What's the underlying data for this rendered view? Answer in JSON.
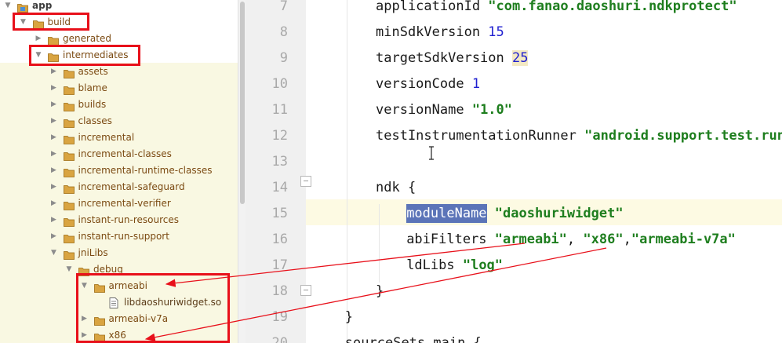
{
  "project_tree": {
    "items": [
      {
        "label": "app",
        "depth": 0,
        "expanded": true,
        "kind": "module",
        "bold": true
      },
      {
        "label": "build",
        "depth": 1,
        "expanded": true,
        "kind": "folder"
      },
      {
        "label": "generated",
        "depth": 2,
        "expanded": false,
        "kind": "folder"
      },
      {
        "label": "intermediates",
        "depth": 2,
        "expanded": true,
        "kind": "folder"
      },
      {
        "label": "assets",
        "depth": 3,
        "expanded": false,
        "kind": "folder"
      },
      {
        "label": "blame",
        "depth": 3,
        "expanded": false,
        "kind": "folder"
      },
      {
        "label": "builds",
        "depth": 3,
        "expanded": false,
        "kind": "folder"
      },
      {
        "label": "classes",
        "depth": 3,
        "expanded": false,
        "kind": "folder"
      },
      {
        "label": "incremental",
        "depth": 3,
        "expanded": false,
        "kind": "folder"
      },
      {
        "label": "incremental-classes",
        "depth": 3,
        "expanded": false,
        "kind": "folder"
      },
      {
        "label": "incremental-runtime-classes",
        "depth": 3,
        "expanded": false,
        "kind": "folder"
      },
      {
        "label": "incremental-safeguard",
        "depth": 3,
        "expanded": false,
        "kind": "folder"
      },
      {
        "label": "incremental-verifier",
        "depth": 3,
        "expanded": false,
        "kind": "folder"
      },
      {
        "label": "instant-run-resources",
        "depth": 3,
        "expanded": false,
        "kind": "folder"
      },
      {
        "label": "instant-run-support",
        "depth": 3,
        "expanded": false,
        "kind": "folder"
      },
      {
        "label": "jniLibs",
        "depth": 3,
        "expanded": true,
        "kind": "folder"
      },
      {
        "label": "debug",
        "depth": 4,
        "expanded": true,
        "kind": "folder"
      },
      {
        "label": "armeabi",
        "depth": 5,
        "expanded": true,
        "kind": "folder"
      },
      {
        "label": "libdaoshuriwidget.so",
        "depth": 6,
        "expanded": null,
        "kind": "file"
      },
      {
        "label": "armeabi-v7a",
        "depth": 5,
        "expanded": false,
        "kind": "folder"
      },
      {
        "label": "x86",
        "depth": 5,
        "expanded": false,
        "kind": "folder"
      }
    ]
  },
  "editor": {
    "line_numbers": [
      "7",
      "8",
      "9",
      "10",
      "11",
      "12",
      "13",
      "14",
      "15",
      "16",
      "17",
      "18",
      "19",
      "20"
    ],
    "lines": [
      {
        "indent": 2,
        "tokens": [
          {
            "t": "applicationId ",
            "c": "plain"
          },
          {
            "t": "\"com.fanao.daoshuri.ndkprotect\"",
            "c": "str"
          }
        ]
      },
      {
        "indent": 2,
        "tokens": [
          {
            "t": "minSdkVersion ",
            "c": "plain"
          },
          {
            "t": "15",
            "c": "num"
          }
        ]
      },
      {
        "indent": 2,
        "tokens": [
          {
            "t": "targetSdkVersion ",
            "c": "plain"
          },
          {
            "t": "25",
            "c": "num-hl"
          }
        ]
      },
      {
        "indent": 2,
        "tokens": [
          {
            "t": "versionCode ",
            "c": "plain"
          },
          {
            "t": "1",
            "c": "num"
          }
        ]
      },
      {
        "indent": 2,
        "tokens": [
          {
            "t": "versionName ",
            "c": "plain"
          },
          {
            "t": "\"1.0\"",
            "c": "str"
          }
        ]
      },
      {
        "indent": 2,
        "tokens": [
          {
            "t": "testInstrumentationRunner ",
            "c": "plain"
          },
          {
            "t": "\"android.support.test.runner.AndroidJUnitRunner\"",
            "c": "str"
          }
        ]
      },
      {
        "indent": 2,
        "tokens": []
      },
      {
        "indent": 2,
        "tokens": [
          {
            "t": "ndk {",
            "c": "plain"
          }
        ]
      },
      {
        "indent": 3,
        "tokens": [
          {
            "t": "moduleName",
            "c": "sel"
          },
          {
            "t": " ",
            "c": "plain"
          },
          {
            "t": "\"daoshuriwidget\"",
            "c": "str"
          }
        ]
      },
      {
        "indent": 3,
        "tokens": [
          {
            "t": "abiFilters ",
            "c": "plain"
          },
          {
            "t": "\"armeabi\"",
            "c": "str"
          },
          {
            "t": ", ",
            "c": "plain"
          },
          {
            "t": "\"x86\"",
            "c": "str"
          },
          {
            "t": ",",
            "c": "plain"
          },
          {
            "t": "\"armeabi-v7a\"",
            "c": "str"
          }
        ]
      },
      {
        "indent": 3,
        "tokens": [
          {
            "t": "ldLibs ",
            "c": "plain"
          },
          {
            "t": "\"log\"",
            "c": "str"
          }
        ]
      },
      {
        "indent": 2,
        "tokens": [
          {
            "t": "}",
            "c": "plain"
          }
        ]
      },
      {
        "indent": 1,
        "tokens": [
          {
            "t": "}",
            "c": "plain"
          }
        ]
      },
      {
        "indent": 1,
        "tokens": [
          {
            "t": "sourceSets.main {",
            "c": "plain"
          }
        ]
      }
    ]
  },
  "colors": {
    "annotation_red": "#e8101a",
    "string_green": "#1e7e1e",
    "number_blue": "#1f1fd0",
    "selection": "#5b74b8",
    "folder_orange": "#d9a441"
  },
  "icons": {
    "expanded": "triangle-down-icon",
    "collapsed": "triangle-right-icon",
    "folder": "folder-icon",
    "module": "module-folder-icon",
    "file": "so-file-icon"
  }
}
